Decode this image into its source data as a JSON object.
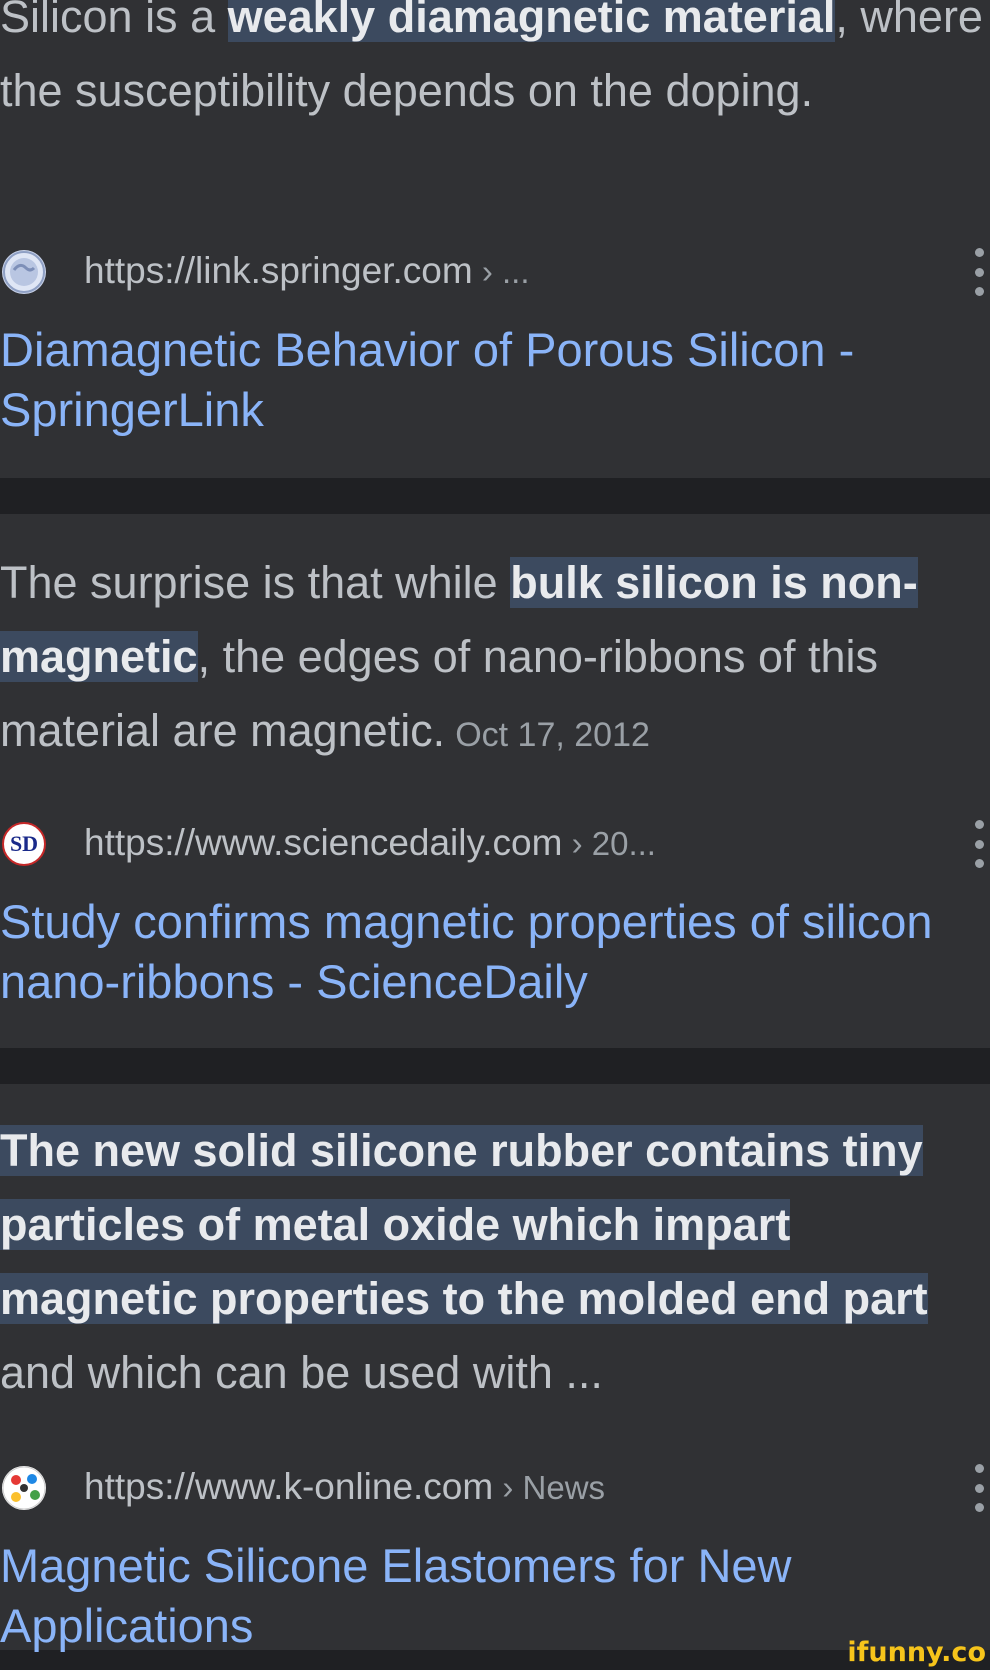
{
  "results": [
    {
      "snippet_pre": "Silicon is a ",
      "snippet_hl": "weakly diamagnetic material",
      "snippet_post": ", where the susceptibility depends on the doping.",
      "url": "https://link.springer.com",
      "crumb": " › ...",
      "title": "Diamagnetic Behavior of Porous Silicon - SpringerLink",
      "favicon": "globe-icon"
    },
    {
      "snippet_pre": "The surprise is that while ",
      "snippet_hl": "bulk silicon is non-magnetic",
      "snippet_post": ", the edges of nano-ribbons of this material are magnetic.",
      "date": "Oct 17, 2012",
      "url": "https://www.sciencedaily.com",
      "crumb": " › 20...",
      "favicon_text": "SD",
      "title": "Study confirms magnetic properties of silicon nano-ribbons - ScienceDaily"
    },
    {
      "snippet_hl": "The new solid silicone rubber contains tiny particles of metal oxide which impart magnetic properties to the molded end part",
      "snippet_post": " and which can be used with ...",
      "url": "https://www.k-online.com",
      "crumb": " › News",
      "title": "Magnetic Silicone Elastomers for New Applications",
      "favicon": "k-online-logo-icon"
    }
  ],
  "watermark": "ifunny.co",
  "colors": {
    "background": "#1f2023",
    "card": "#303134",
    "link": "#8ab4f8",
    "highlight": "#3c4a5f"
  }
}
